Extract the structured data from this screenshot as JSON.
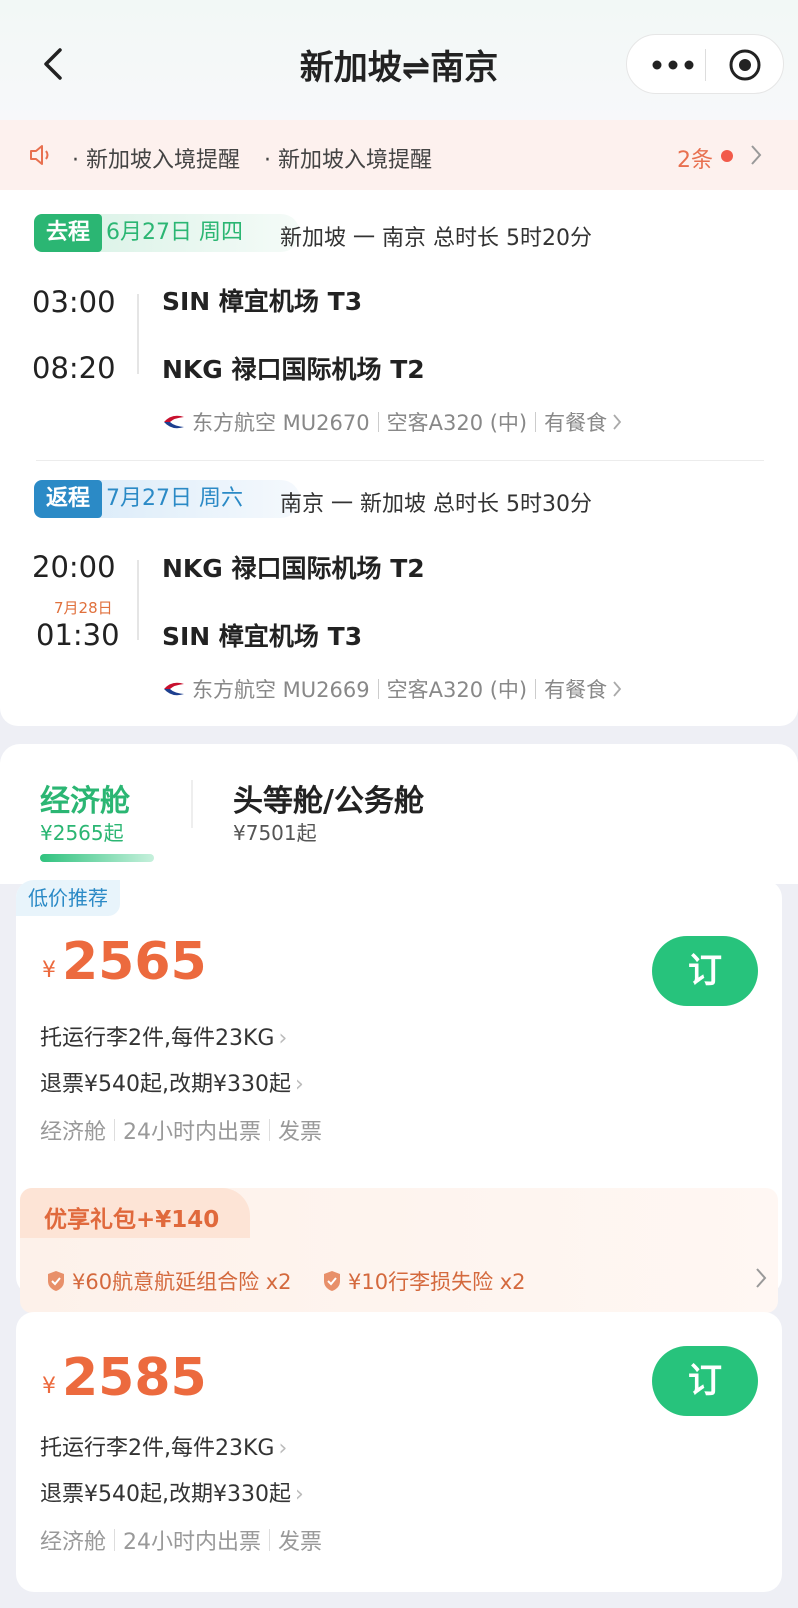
{
  "header": {
    "title": "新加坡⇌南京"
  },
  "notice": {
    "items": [
      "· 新加坡入境提醒",
      "· 新加坡入境提醒"
    ],
    "count": "2条"
  },
  "segments": [
    {
      "tag": "去程",
      "date": "6月27日 周四",
      "route": "新加坡 一 南京  总时长 5时20分",
      "dep_time": "03:00",
      "arr_time": "08:20",
      "next_day": "",
      "dep_airport": "SIN 樟宜机场 T3",
      "arr_airport": "NKG 禄口国际机场 T2",
      "airline": "东方航空 MU2670",
      "aircraft": "空客A320 (中)",
      "meal": "有餐食"
    },
    {
      "tag": "返程",
      "date": "7月27日 周六",
      "route": "南京 一 新加坡  总时长 5时30分",
      "dep_time": "20:00",
      "arr_time": "01:30",
      "next_day": "7月28日",
      "dep_airport": "NKG 禄口国际机场 T2",
      "arr_airport": "SIN 樟宜机场 T3",
      "airline": "东方航空 MU2669",
      "aircraft": "空客A320 (中)",
      "meal": "有餐食"
    }
  ],
  "cabins": [
    {
      "name": "经济舱",
      "price": "¥2565起"
    },
    {
      "name": "头等舱/公务舱",
      "price": "¥7501起"
    }
  ],
  "fares": [
    {
      "tag": "低价推荐",
      "currency": "¥",
      "price": "2565",
      "book": "订",
      "baggage": "托运行李2件,每件23KG",
      "refund": "退票¥540起,改期¥330起",
      "meta": [
        "经济舱",
        "24小时内出票",
        "发票"
      ],
      "gift": {
        "title": "优享礼包+¥140",
        "items": [
          "¥60航意航延组合险  x2",
          "¥10行李损失险  x2"
        ]
      }
    },
    {
      "tag": "",
      "currency": "¥",
      "price": "2585",
      "book": "订",
      "baggage": "托运行李2件,每件23KG",
      "refund": "退票¥540起,改期¥330起",
      "meta": [
        "经济舱",
        "24小时内出票",
        "发票"
      ]
    }
  ],
  "colors": {
    "green": "#27c37c",
    "orange": "#ec6a3e",
    "blue": "#2b8ac6"
  }
}
